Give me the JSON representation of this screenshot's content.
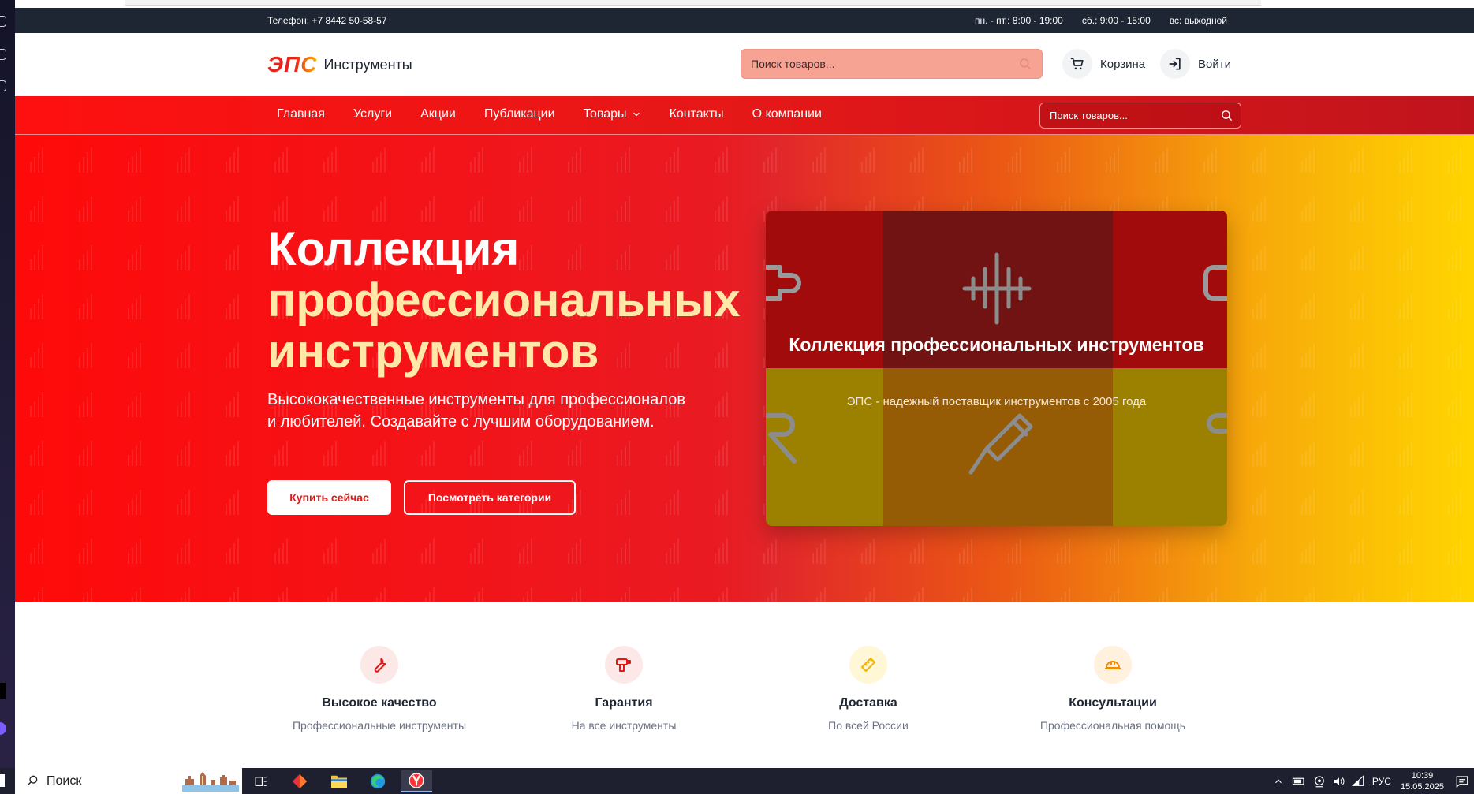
{
  "infobar": {
    "phone": "Телефон: +7 8442 50-58-57",
    "hours": [
      "пн. - пт.: 8:00 - 19:00",
      "сб.: 9:00 - 15:00",
      "вс: выходной"
    ]
  },
  "header": {
    "logo_mark": "ЭПС",
    "logo_text": "Инструменты",
    "search_placeholder": "Поиск товаров...",
    "cart_label": "Корзина",
    "login_label": "Войти"
  },
  "nav": {
    "items": [
      "Главная",
      "Услуги",
      "Акции",
      "Публикации",
      "Товары",
      "Контакты",
      "О компании"
    ],
    "search_placeholder": "Поиск товаров..."
  },
  "hero": {
    "title_line1": "Коллекция",
    "title_line2": "профессиональных",
    "title_line3": "инструментов",
    "subtitle": "Высококачественные инструменты для профессионалов и любителей. Создавайте с лучшим оборудованием.",
    "buy_button": "Купить сейчас",
    "categories_button": "Посмотреть категории",
    "card_title": "Коллекция профессиональных инструментов",
    "card_subtitle": "ЭПС - надежный поставщик инструментов с 2005 года"
  },
  "features": [
    {
      "title": "Высокое качество",
      "subtitle": "Профессиональные инструменты",
      "icon": "wrench-icon",
      "color": "#e51818"
    },
    {
      "title": "Гарантия",
      "subtitle": "На все инструменты",
      "icon": "drill-icon",
      "color": "#e51818"
    },
    {
      "title": "Доставка",
      "subtitle": "По всей России",
      "icon": "ruler-icon",
      "color": "#f5b400"
    },
    {
      "title": "Консультации",
      "subtitle": "Профессиональная помощь",
      "icon": "hardhat-icon",
      "color": "#f08a00"
    }
  ],
  "taskbar": {
    "search_label": "Поиск",
    "lang": "РУС",
    "time": "10:39",
    "date": "15.05.2025"
  },
  "colors": {
    "brand_red": "#e51818",
    "brand_yellow": "#ffd500",
    "dark": "#1f2633"
  }
}
